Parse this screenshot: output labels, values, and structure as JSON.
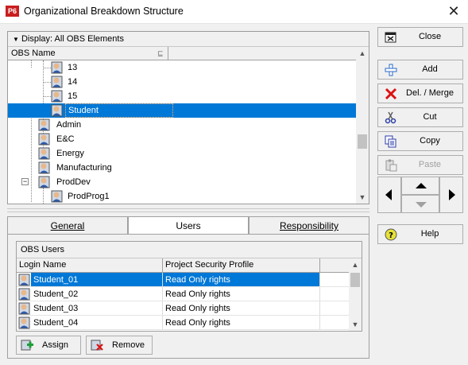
{
  "window": {
    "app_icon": "P6",
    "title": "Organizational Breakdown Structure",
    "close_glyph": "✕"
  },
  "tree": {
    "display_label": "Display: All OBS Elements",
    "column_header": "OBS Name",
    "rows": [
      {
        "label": "13"
      },
      {
        "label": "14"
      },
      {
        "label": "15"
      },
      {
        "label": "Student"
      },
      {
        "label": "Admin"
      },
      {
        "label": "E&C"
      },
      {
        "label": "Energy"
      },
      {
        "label": "Manufacturing"
      },
      {
        "label": "ProdDev"
      },
      {
        "label": "ProdProg1"
      }
    ],
    "expander_glyph": "−"
  },
  "tabs": {
    "general": "General",
    "users": "Users",
    "responsibility": "Responsibility"
  },
  "users": {
    "section_title": "OBS Users",
    "columns": {
      "login": "Login Name",
      "profile": "Project Security Profile"
    },
    "rows": [
      {
        "login": "Student_01",
        "profile": "Read Only rights"
      },
      {
        "login": "Student_02",
        "profile": "Read Only rights"
      },
      {
        "login": "Student_03",
        "profile": "Read Only rights"
      },
      {
        "login": "Student_04",
        "profile": "Read Only rights"
      }
    ],
    "assign_label": "Assign",
    "remove_label": "Remove"
  },
  "buttons": {
    "close": "Close",
    "add": "Add",
    "del_merge": "Del. / Merge",
    "cut": "Cut",
    "copy": "Copy",
    "paste": "Paste",
    "help": "Help"
  },
  "colors": {
    "selection": "#0078d7",
    "app_icon_bg": "#c81e1e"
  }
}
